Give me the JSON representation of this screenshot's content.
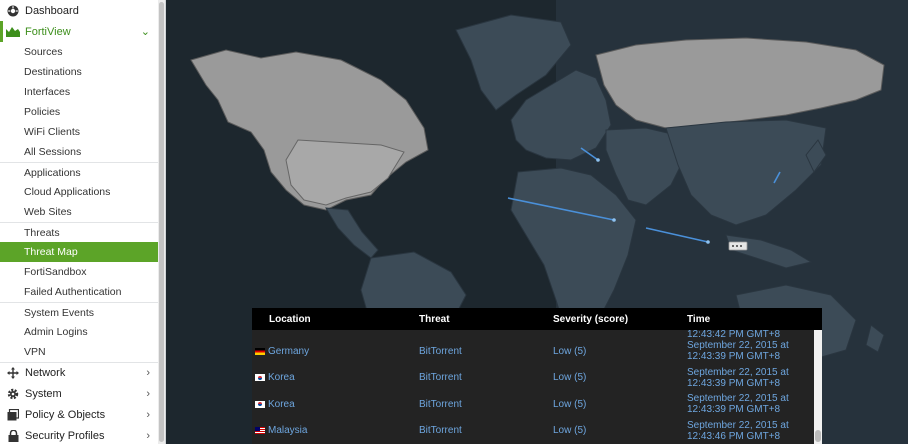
{
  "sidebar": {
    "top_items": [
      {
        "label": "Dashboard",
        "icon": "dashboard-icon"
      },
      {
        "label": "FortiView",
        "icon": "area-chart-icon"
      }
    ],
    "fortiview_items": [
      "Sources",
      "Destinations",
      "Interfaces",
      "Policies",
      "WiFi Clients",
      "All Sessions",
      "Applications",
      "Cloud Applications",
      "Web Sites",
      "Threats",
      "Threat Map",
      "FortiSandbox",
      "Failed Authentication",
      "System Events",
      "Admin Logins",
      "VPN"
    ],
    "active_item": "Threat Map",
    "bottom_items": [
      {
        "label": "Network",
        "icon": "network-icon"
      },
      {
        "label": "System",
        "icon": "gear-icon"
      },
      {
        "label": "Policy & Objects",
        "icon": "policy-icon"
      },
      {
        "label": "Security Profiles",
        "icon": "lock-icon"
      }
    ]
  },
  "threat_table": {
    "columns": [
      "Location",
      "Threat",
      "Severity (score)",
      "Time"
    ],
    "partial_time": "12:43:42 PM GMT+8",
    "rows": [
      {
        "location": "Germany",
        "flag": "de",
        "threat": "BitTorrent",
        "severity": "Low (5)",
        "time_line1": "September 22, 2015 at",
        "time_line2": "12:43:39 PM GMT+8"
      },
      {
        "location": "Korea",
        "flag": "kr",
        "threat": "BitTorrent",
        "severity": "Low (5)",
        "time_line1": "September 22, 2015 at",
        "time_line2": "12:43:39 PM GMT+8"
      },
      {
        "location": "Korea",
        "flag": "kr",
        "threat": "BitTorrent",
        "severity": "Low (5)",
        "time_line1": "September 22, 2015 at",
        "time_line2": "12:43:39 PM GMT+8"
      },
      {
        "location": "Malaysia",
        "flag": "my",
        "threat": "BitTorrent",
        "severity": "Low (5)",
        "time_line1": "September 22, 2015 at",
        "time_line2": "12:43:46 PM GMT+8"
      }
    ]
  },
  "colors": {
    "accent": "#5ca428",
    "map_bg": "#26323c",
    "land": "#3c4b57",
    "highlight_land": "#9a9a9a",
    "attack_line": "#4a90d9"
  }
}
